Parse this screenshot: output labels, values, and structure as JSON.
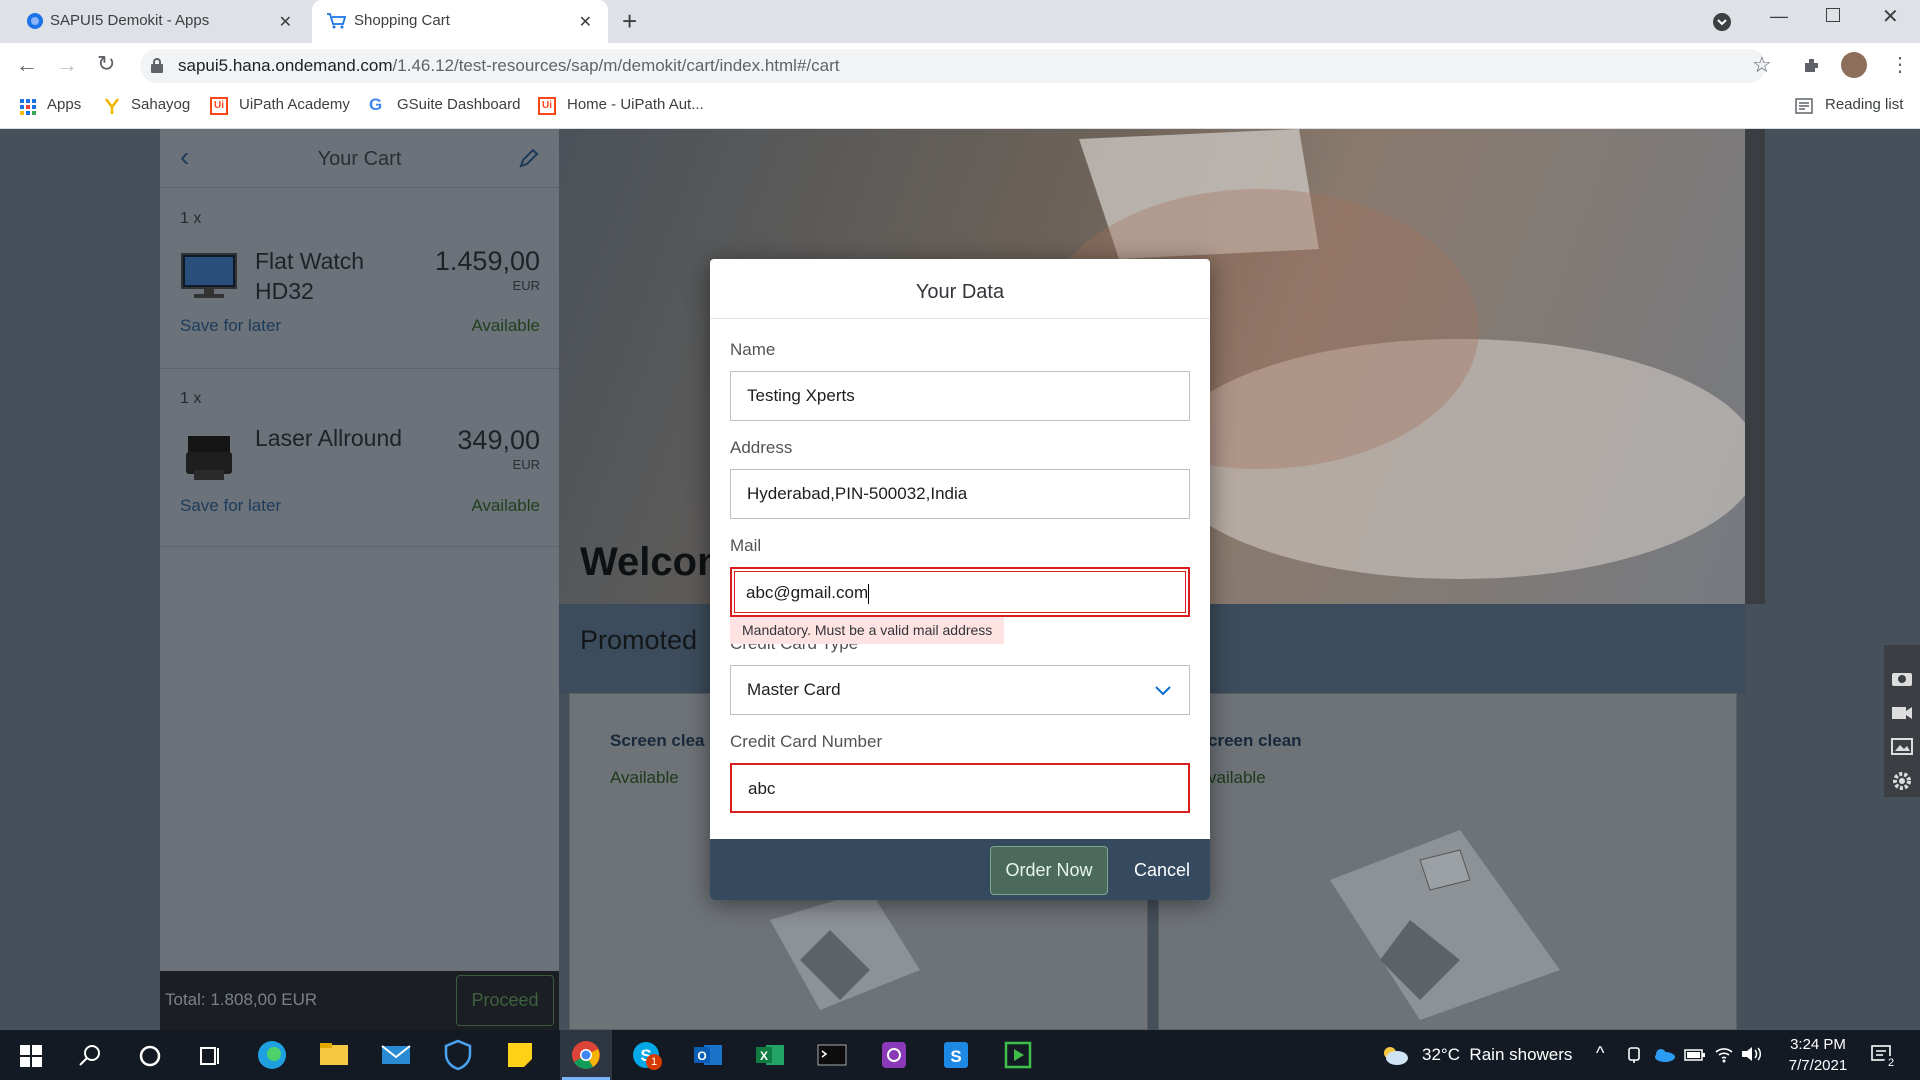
{
  "browser": {
    "tabs": [
      {
        "label": "SAPUI5 Demokit - Apps",
        "active": false
      },
      {
        "label": "Shopping Cart",
        "active": true
      }
    ],
    "url_host": "sapui5.hana.ondemand.com",
    "url_path": "/1.46.12/test-resources/sap/m/demokit/cart/index.html#/cart",
    "bookmarks": [
      "Apps",
      "Sahayog",
      "UiPath Academy",
      "GSuite Dashboard",
      "Home - UiPath Aut..."
    ],
    "reading_list": "Reading list"
  },
  "cart": {
    "title": "Your Cart",
    "items": [
      {
        "qty": "1 x",
        "name_line1": "Flat Watch",
        "name_line2": "HD32",
        "price": "1.459,00",
        "currency": "EUR",
        "save_label": "Save for later",
        "status": "Available"
      },
      {
        "qty": "1 x",
        "name_line1": "Laser Allround",
        "name_line2": "",
        "price": "349,00",
        "currency": "EUR",
        "save_label": "Save for later",
        "status": "Available"
      }
    ],
    "total": "Total: 1.808,00 EUR",
    "proceed_label": "Proceed"
  },
  "home": {
    "welcome": "Welcon",
    "promoted": "Promoted",
    "cards": [
      {
        "name": "Screen clea",
        "status": "Available"
      },
      {
        "name": "creen clean",
        "status": "vailable"
      }
    ]
  },
  "dialog": {
    "title": "Your Data",
    "name_label": "Name",
    "name_value": "Testing Xperts",
    "address_label": "Address",
    "address_value": "Hyderabad,PIN-500032,India",
    "mail_label": "Mail",
    "mail_value": "abc@gmail.com",
    "mail_error": "Mandatory. Must be a valid mail address",
    "cctype_label": "Credit Card Type",
    "cctype_value": "Master Card",
    "ccnum_label": "Credit Card Number",
    "ccnum_value": "abc",
    "order_label": "Order Now",
    "cancel_label": "Cancel"
  },
  "taskbar": {
    "weather": "32°C  Rain showers",
    "time": "3:24 PM",
    "date": "7/7/2021",
    "notification_count": "2",
    "skype_badge": "1"
  },
  "colors": {
    "accent": "#0a6ed1",
    "error": "#d81e1e",
    "dialog_footer": "#354a5f",
    "taskbar": "#141a24"
  }
}
